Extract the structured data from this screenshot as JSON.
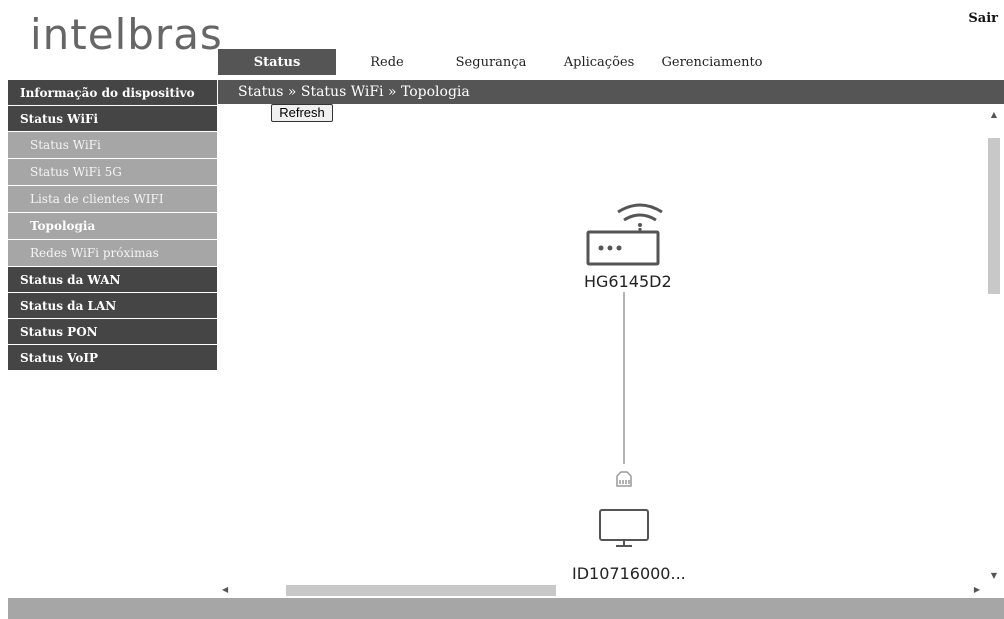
{
  "header": {
    "logo": "intelbras",
    "logout": "Sair"
  },
  "topnav": {
    "tabs": [
      {
        "label": "Status",
        "active": true
      },
      {
        "label": "Rede",
        "active": false
      },
      {
        "label": "Segurança",
        "active": false
      },
      {
        "label": "Aplicações",
        "active": false
      },
      {
        "label": "Gerenciamento",
        "active": false
      }
    ]
  },
  "sidebar": {
    "items": [
      {
        "label": "Informação do dispositivo"
      },
      {
        "label": "Status WiFi",
        "subitems": [
          {
            "label": "Status WiFi",
            "active": false
          },
          {
            "label": "Status WiFi 5G",
            "active": false
          },
          {
            "label": "Lista de clientes WIFI",
            "active": false
          },
          {
            "label": "Topologia",
            "active": true
          },
          {
            "label": "Redes WiFi próximas",
            "active": false
          }
        ]
      },
      {
        "label": "Status da WAN"
      },
      {
        "label": "Status da LAN"
      },
      {
        "label": "Status PON"
      },
      {
        "label": "Status VoIP"
      }
    ]
  },
  "breadcrumb": "Status » Status WiFi » Topologia",
  "main": {
    "refresh_label": "Refresh",
    "router_label": "HG6145D2",
    "client_label": "ID10716000..."
  },
  "icons": {
    "router": "router-icon",
    "ethernet": "ethernet-port-icon",
    "computer": "monitor-icon"
  },
  "colors": {
    "dark_bar": "#555555",
    "sidebar_dark": "#454545",
    "sidebar_light": "#a6a6a6",
    "logo": "#666666"
  }
}
